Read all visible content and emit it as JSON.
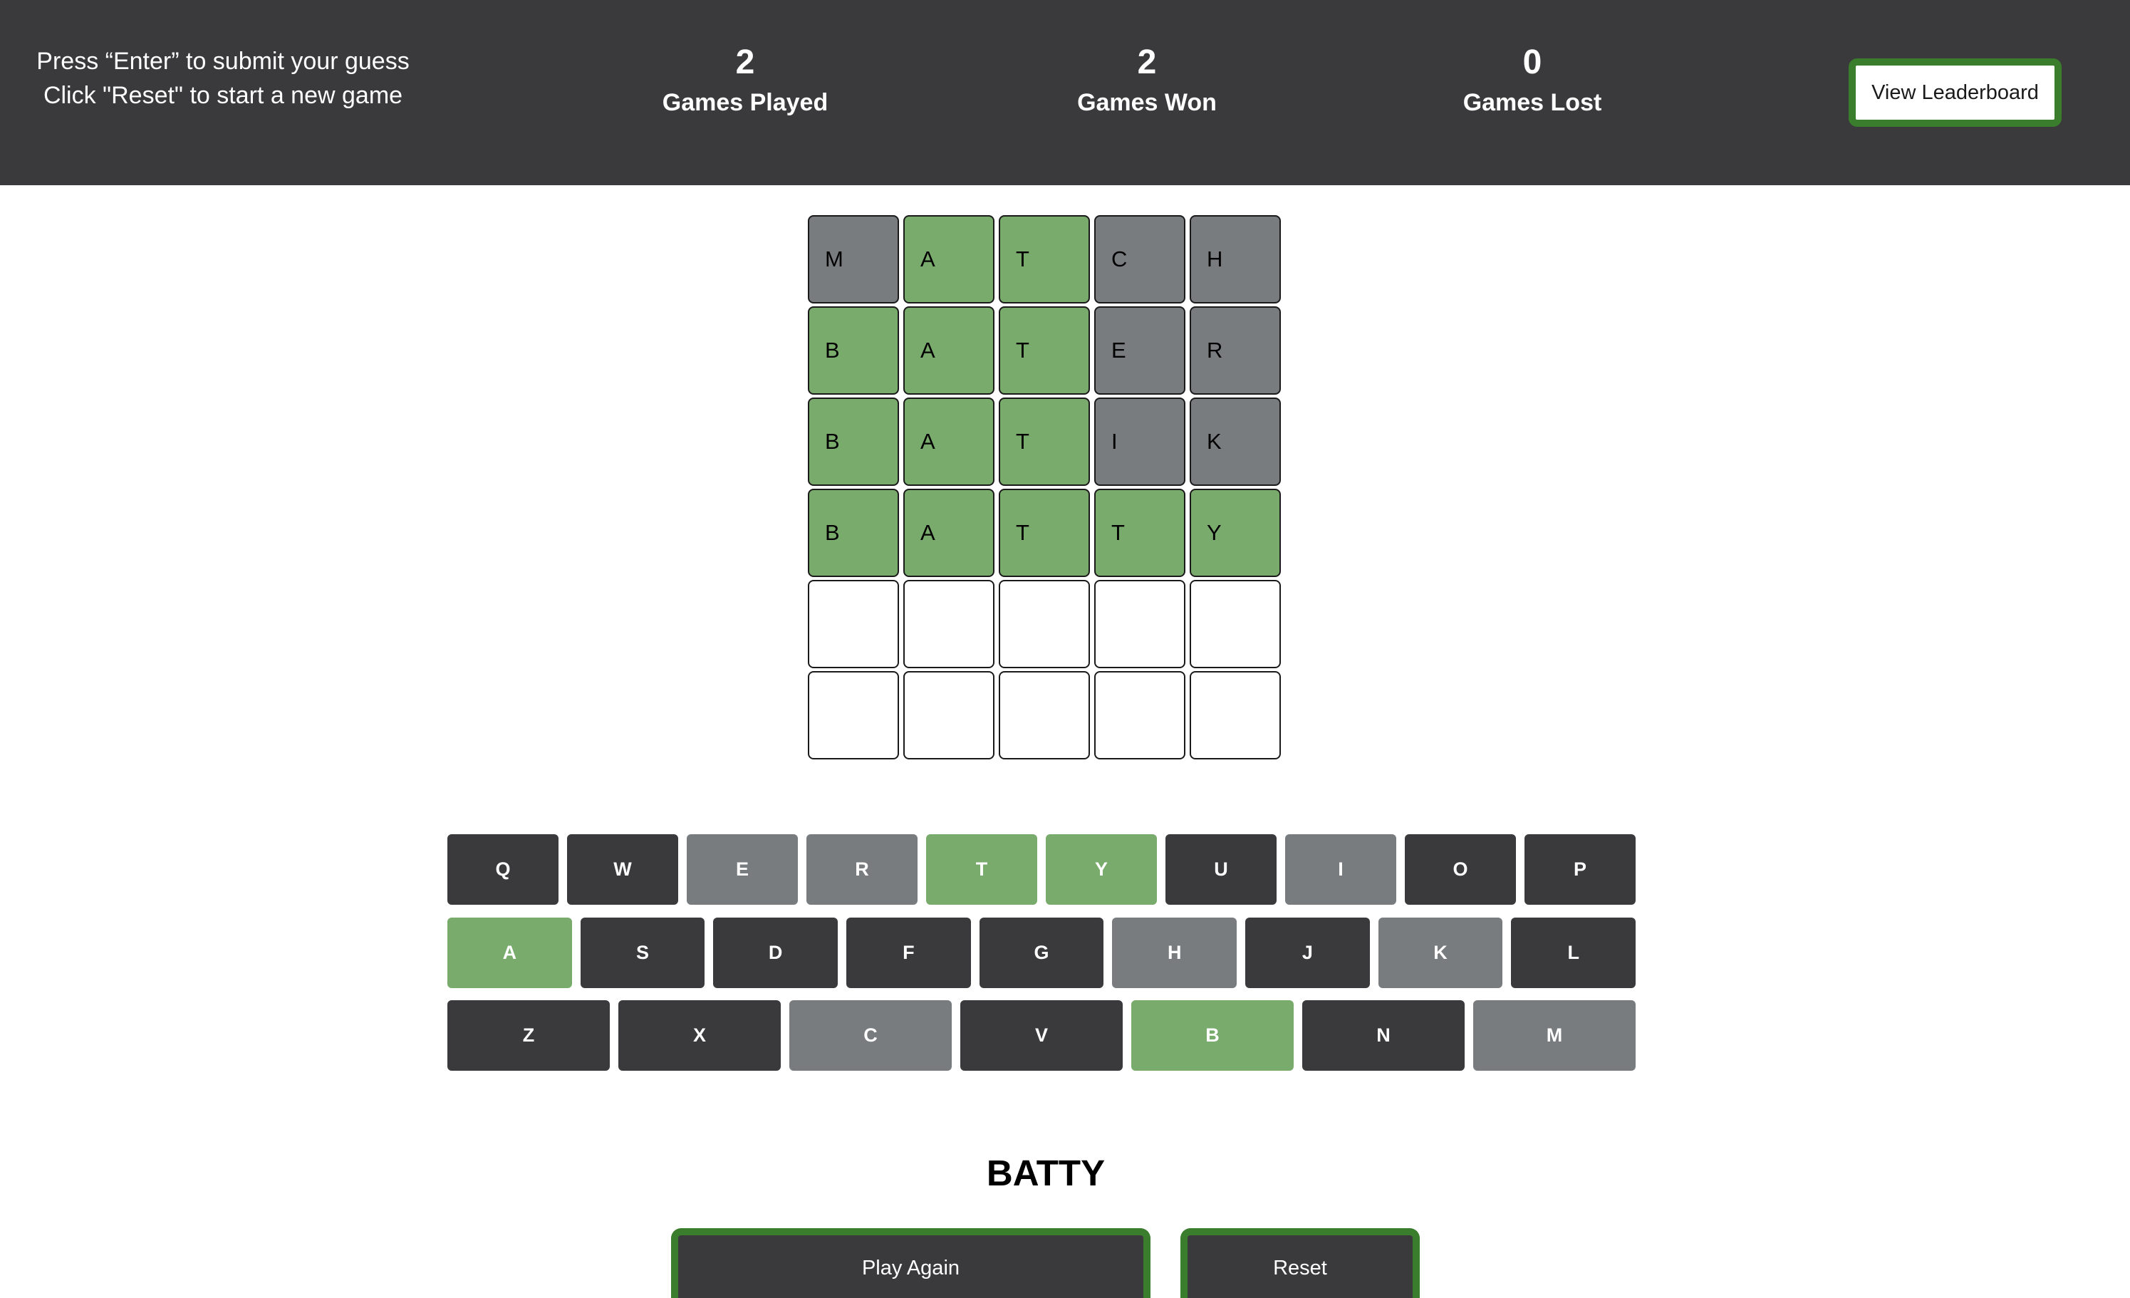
{
  "header": {
    "instruction_line1": "Press “Enter” to submit your guess",
    "instruction_line2": "Click \"Reset\" to start a new game",
    "stats": {
      "games_played": {
        "value": "2",
        "label": "Games Played"
      },
      "games_won": {
        "value": "2",
        "label": "Games Won"
      },
      "games_lost": {
        "value": "0",
        "label": "Games Lost"
      }
    },
    "leaderboard_button": "View Leaderboard"
  },
  "board": [
    [
      {
        "letter": "M",
        "state": "gray"
      },
      {
        "letter": "A",
        "state": "green"
      },
      {
        "letter": "T",
        "state": "green"
      },
      {
        "letter": "C",
        "state": "gray"
      },
      {
        "letter": "H",
        "state": "gray"
      }
    ],
    [
      {
        "letter": "B",
        "state": "green"
      },
      {
        "letter": "A",
        "state": "green"
      },
      {
        "letter": "T",
        "state": "green"
      },
      {
        "letter": "E",
        "state": "gray"
      },
      {
        "letter": "R",
        "state": "gray"
      }
    ],
    [
      {
        "letter": "B",
        "state": "green"
      },
      {
        "letter": "A",
        "state": "green"
      },
      {
        "letter": "T",
        "state": "green"
      },
      {
        "letter": "I",
        "state": "gray"
      },
      {
        "letter": "K",
        "state": "gray"
      }
    ],
    [
      {
        "letter": "B",
        "state": "green"
      },
      {
        "letter": "A",
        "state": "green"
      },
      {
        "letter": "T",
        "state": "green"
      },
      {
        "letter": "T",
        "state": "green"
      },
      {
        "letter": "Y",
        "state": "green"
      }
    ],
    [
      {
        "letter": "",
        "state": "empty"
      },
      {
        "letter": "",
        "state": "empty"
      },
      {
        "letter": "",
        "state": "empty"
      },
      {
        "letter": "",
        "state": "empty"
      },
      {
        "letter": "",
        "state": "empty"
      }
    ],
    [
      {
        "letter": "",
        "state": "empty"
      },
      {
        "letter": "",
        "state": "empty"
      },
      {
        "letter": "",
        "state": "empty"
      },
      {
        "letter": "",
        "state": "empty"
      },
      {
        "letter": "",
        "state": "empty"
      }
    ]
  ],
  "keyboard": [
    [
      {
        "key": "Q",
        "state": "unused"
      },
      {
        "key": "W",
        "state": "unused"
      },
      {
        "key": "E",
        "state": "gray"
      },
      {
        "key": "R",
        "state": "gray"
      },
      {
        "key": "T",
        "state": "green"
      },
      {
        "key": "Y",
        "state": "green"
      },
      {
        "key": "U",
        "state": "unused"
      },
      {
        "key": "I",
        "state": "gray"
      },
      {
        "key": "O",
        "state": "unused"
      },
      {
        "key": "P",
        "state": "unused"
      }
    ],
    [
      {
        "key": "A",
        "state": "green"
      },
      {
        "key": "S",
        "state": "unused"
      },
      {
        "key": "D",
        "state": "unused"
      },
      {
        "key": "F",
        "state": "unused"
      },
      {
        "key": "G",
        "state": "unused"
      },
      {
        "key": "H",
        "state": "gray"
      },
      {
        "key": "J",
        "state": "unused"
      },
      {
        "key": "K",
        "state": "gray"
      },
      {
        "key": "L",
        "state": "unused"
      }
    ],
    [
      {
        "key": "Z",
        "state": "unused"
      },
      {
        "key": "X",
        "state": "unused"
      },
      {
        "key": "C",
        "state": "gray"
      },
      {
        "key": "V",
        "state": "unused"
      },
      {
        "key": "B",
        "state": "green"
      },
      {
        "key": "N",
        "state": "unused"
      },
      {
        "key": "M",
        "state": "gray"
      }
    ]
  ],
  "answer": "BATTY",
  "actions": {
    "play_again": "Play Again",
    "reset": "Reset"
  },
  "colors": {
    "header_bg": "#3a3a3c",
    "tile_correct": "#79ab6c",
    "tile_absent": "#787c7f",
    "key_unused": "#3a3a3c",
    "button_border": "#3a7d2c"
  }
}
